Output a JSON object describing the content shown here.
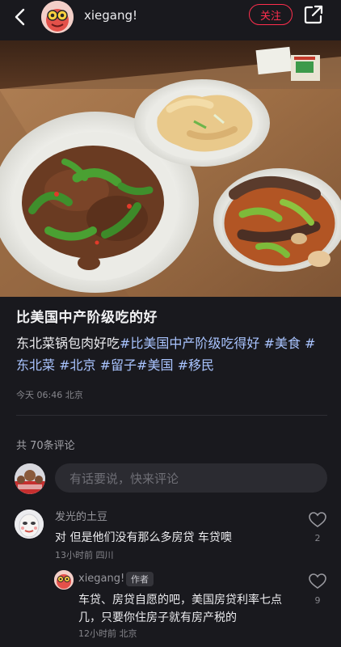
{
  "header": {
    "username": "xiegang!",
    "follow_label": "关注"
  },
  "post": {
    "title": "比美国中产阶级吃的好",
    "desc_plain": "东北菜锅包肉好吃",
    "tags": [
      "#比美国中产阶级吃得好",
      "#美食",
      "#东北菜",
      "#北京",
      "#留子",
      "#美国",
      "#移民"
    ],
    "timestamp": "今天 06:46 北京"
  },
  "comments_section": {
    "count_label": "共 70条评论",
    "input_placeholder": "有话要说，快来评论"
  },
  "comments": [
    {
      "name": "发光的土豆",
      "text": "对 但是他们没有那么多房贷 车贷噢",
      "meta": "13小时前 四川",
      "likes": "2",
      "reply": {
        "name": "xiegang!",
        "badge": "作者",
        "text": "车贷、房贷自愿的吧，美国房贷利率七点几，只要你住房子就有房产税的",
        "meta": "12小时前 北京",
        "likes": "9"
      }
    }
  ],
  "colors": {
    "background": "#19191e",
    "accent": "#ff2e4d",
    "tag": "#a9c4ff"
  }
}
